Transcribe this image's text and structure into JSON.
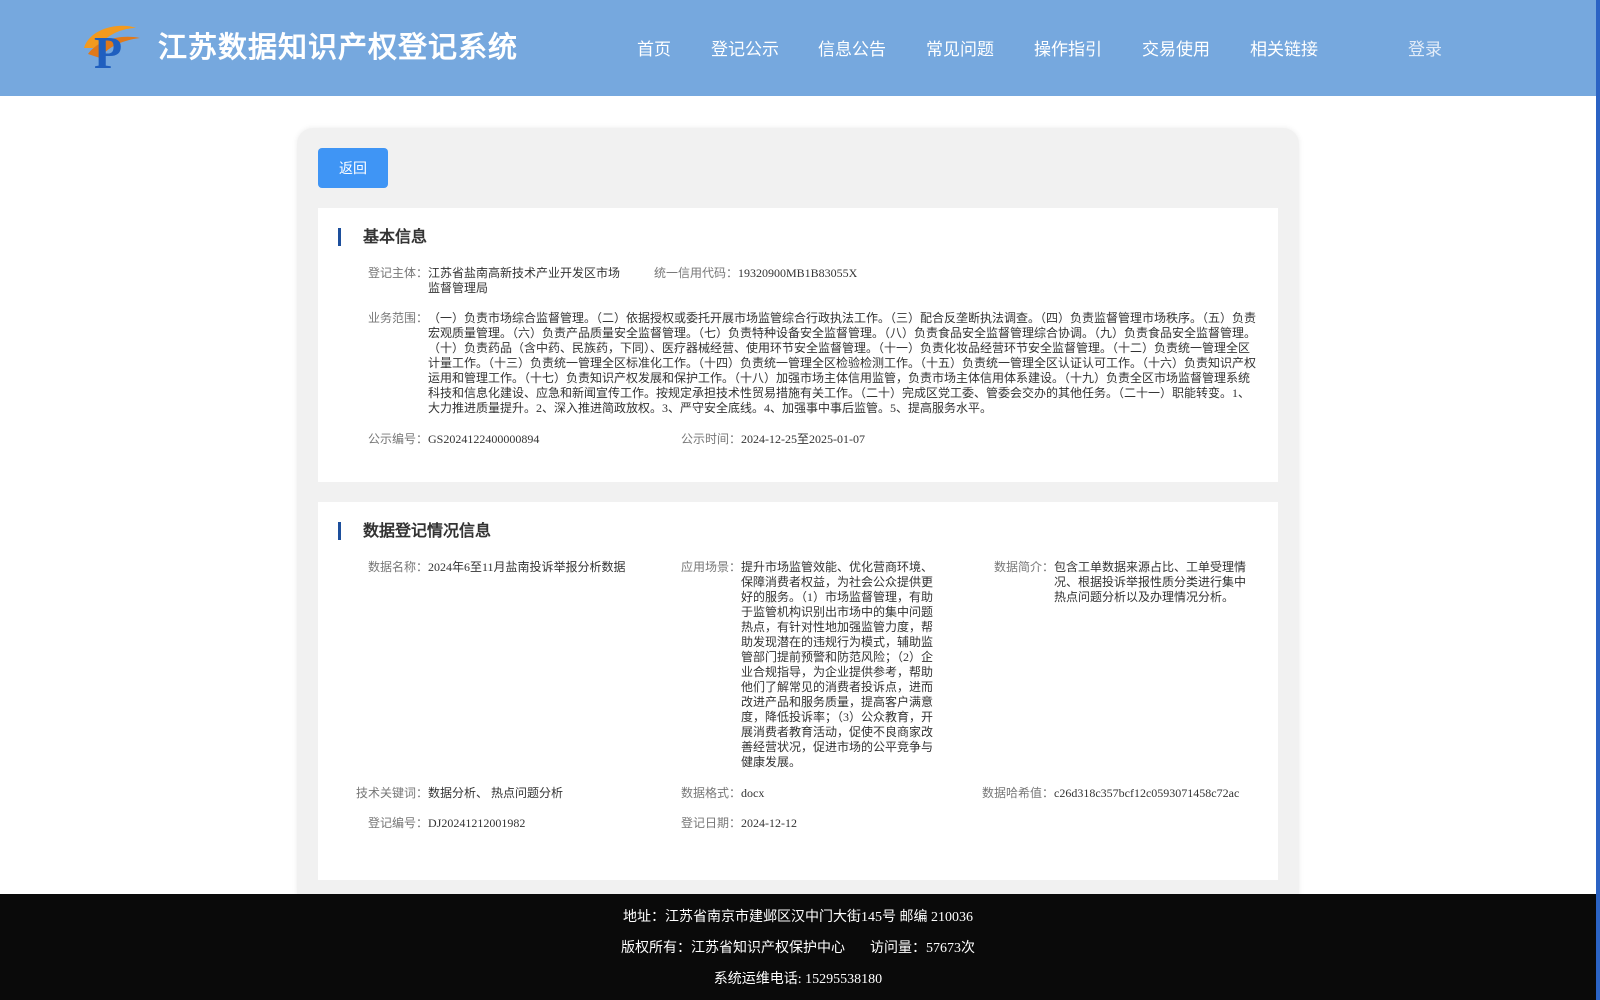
{
  "header": {
    "site_title": "江苏数据知识产权登记系统",
    "nav": [
      "首页",
      "登记公示",
      "信息公告",
      "常见问题",
      "操作指引",
      "交易使用",
      "相关链接"
    ],
    "login": "登录"
  },
  "main": {
    "back_label": "返回",
    "basic": {
      "title": "基本信息",
      "registrant_label": "登记主体：",
      "registrant": "江苏省盐南高新技术产业开发区市场监督管理局",
      "credit_code_label": "统一信用代码：",
      "credit_code": "19320900MB1B83055X",
      "scope_label": "业务范围：",
      "scope": "（一）负责市场综合监督管理。（二）依据授权或委托开展市场监管综合行政执法工作。（三）配合反垄断执法调查。（四）负责监督管理市场秩序。（五）负责宏观质量管理。（六）负责产品质量安全监督管理。（七）负责特种设备安全监督管理。（八）负责食品安全监督管理综合协调。（九）负责食品安全监督管理。（十）负责药品（含中药、民族药，下同）、医疗器械经营、使用环节安全监督管理。（十一）负责化妆品经营环节安全监督管理。（十二）负责统一管理全区计量工作。（十三）负责统一管理全区标准化工作。（十四）负责统一管理全区检验检测工作。（十五）负责统一管理全区认证认可工作。（十六）负责知识产权运用和管理工作。（十七）负责知识产权发展和保护工作。（十八）加强市场主体信用监管，负责市场主体信用体系建设。（十九）负责全区市场监督管理系统科技和信息化建设、应急和新闻宣传工作。按规定承担技术性贸易措施有关工作。（二十）完成区党工委、管委会交办的其他任务。（二十一）职能转变。1、大力推进质量提升。2、深入推进简政放权。3、严守安全底线。4、加强事中事后监管。5、提高服务水平。",
      "pub_no_label": "公示编号：",
      "pub_no": "GS2024122400000894",
      "pub_time_label": "公示时间：",
      "pub_time": "2024-12-25至2025-01-07"
    },
    "data": {
      "title": "数据登记情况信息",
      "name_label": "数据名称：",
      "name": "2024年6至11月盐南投诉举报分析数据",
      "scene_label": "应用场景：",
      "scene": "提升市场监管效能、优化营商环境、保障消费者权益，为社会公众提供更好的服务。（1）市场监督管理，有助于监管机构识别出市场中的集中问题热点，有针对性地加强监管力度，帮助发现潜在的违规行为模式，辅助监管部门提前预警和防范风险；（2）企业合规指导，为企业提供参考，帮助他们了解常见的消费者投诉点，进而改进产品和服务质量，提高客户满意度，降低投诉率；（3）公众教育，开展消费者教育活动，促使不良商家改善经营状况，促进市场的公平竞争与健康发展。",
      "intro_label": "数据简介：",
      "intro": "包含工单数据来源占比、工单受理情况、根据投诉举报性质分类进行集中热点问题分析以及办理情况分析。",
      "keywords_label": "技术关键词：",
      "keywords": "数据分析、 热点问题分析",
      "format_label": "数据格式：",
      "format": "docx",
      "hash_label": "数据哈希值：",
      "hash": "c26d318c357bcf12c0593071458c72ac",
      "reg_no_label": "登记编号：",
      "reg_no": "DJ20241212001982",
      "reg_date_label": "登记日期：",
      "reg_date": "2024-12-12"
    }
  },
  "footer": {
    "address": "地址：江苏省南京市建邺区汉中门大街145号 邮编 210036",
    "copyright": "版权所有：江苏省知识产权保护中心",
    "visits": "访问量：57673次",
    "phone": "系统运维电话: 15295538180"
  },
  "colors": {
    "header_bg": "#76a8de",
    "button_bg": "#3f95f5",
    "accent_bar": "#1d4f9c",
    "footer_bg": "#0a0a0a"
  }
}
